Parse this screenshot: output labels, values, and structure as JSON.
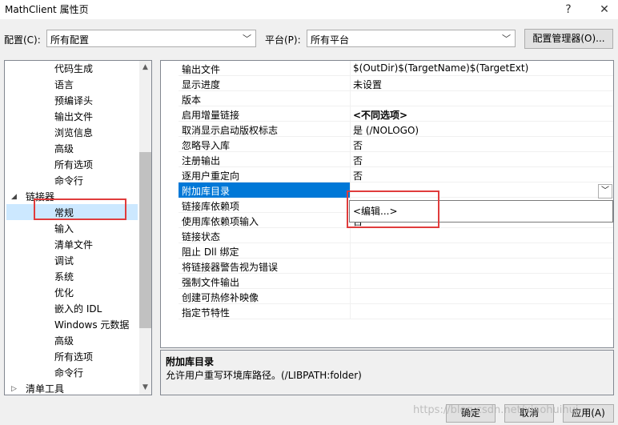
{
  "window": {
    "title": "MathClient 属性页",
    "help": "?",
    "close": "✕"
  },
  "toolbar": {
    "config_label": "配置(C):",
    "config_value": "所有配置",
    "platform_label": "平台(P):",
    "platform_value": "所有平台",
    "config_manager": "配置管理器(O)..."
  },
  "tree": {
    "items": [
      {
        "label": "代码生成",
        "level": 2
      },
      {
        "label": "语言",
        "level": 2
      },
      {
        "label": "预编译头",
        "level": 2
      },
      {
        "label": "输出文件",
        "level": 2
      },
      {
        "label": "浏览信息",
        "level": 2
      },
      {
        "label": "高级",
        "level": 2
      },
      {
        "label": "所有选项",
        "level": 2
      },
      {
        "label": "命令行",
        "level": 2
      },
      {
        "label": "链接器",
        "level": 1,
        "expanded": true
      },
      {
        "label": "常规",
        "level": 2,
        "selected": true
      },
      {
        "label": "输入",
        "level": 2
      },
      {
        "label": "清单文件",
        "level": 2
      },
      {
        "label": "调试",
        "level": 2
      },
      {
        "label": "系统",
        "level": 2
      },
      {
        "label": "优化",
        "level": 2
      },
      {
        "label": "嵌入的 IDL",
        "level": 2
      },
      {
        "label": "Windows 元数据",
        "level": 2
      },
      {
        "label": "高级",
        "level": 2
      },
      {
        "label": "所有选项",
        "level": 2
      },
      {
        "label": "命令行",
        "level": 2
      },
      {
        "label": "清单工具",
        "level": 1,
        "expanded": false
      }
    ]
  },
  "properties": [
    {
      "name": "输出文件",
      "value": "$(OutDir)$(TargetName)$(TargetExt)"
    },
    {
      "name": "显示进度",
      "value": "未设置"
    },
    {
      "name": "版本",
      "value": ""
    },
    {
      "name": "启用增量链接",
      "value": "<不同选项>"
    },
    {
      "name": "取消显示启动版权标志",
      "value": "是 (/NOLOGO)"
    },
    {
      "name": "忽略导入库",
      "value": "否"
    },
    {
      "name": "注册输出",
      "value": "否"
    },
    {
      "name": "逐用户重定向",
      "value": "否"
    },
    {
      "name": "附加库目录",
      "value": "",
      "selected": true
    },
    {
      "name": "链接库依赖项",
      "value": ""
    },
    {
      "name": "使用库依赖项输入",
      "value": "否"
    },
    {
      "name": "链接状态",
      "value": ""
    },
    {
      "name": "阻止 Dll 绑定",
      "value": ""
    },
    {
      "name": "将链接器警告视为错误",
      "value": ""
    },
    {
      "name": "强制文件输出",
      "value": ""
    },
    {
      "name": "创建可热修补映像",
      "value": ""
    },
    {
      "name": "指定节特性",
      "value": ""
    }
  ],
  "dropdown": {
    "option": "<编辑...>"
  },
  "description": {
    "title": "附加库目录",
    "text": "允许用户重写环境库路径。(/LIBPATH:folder)"
  },
  "buttons": {
    "ok": "确定",
    "cancel": "取消",
    "apply": "应用(A)"
  },
  "watermark": "https://blog.csdn.net/xiaohuihui"
}
